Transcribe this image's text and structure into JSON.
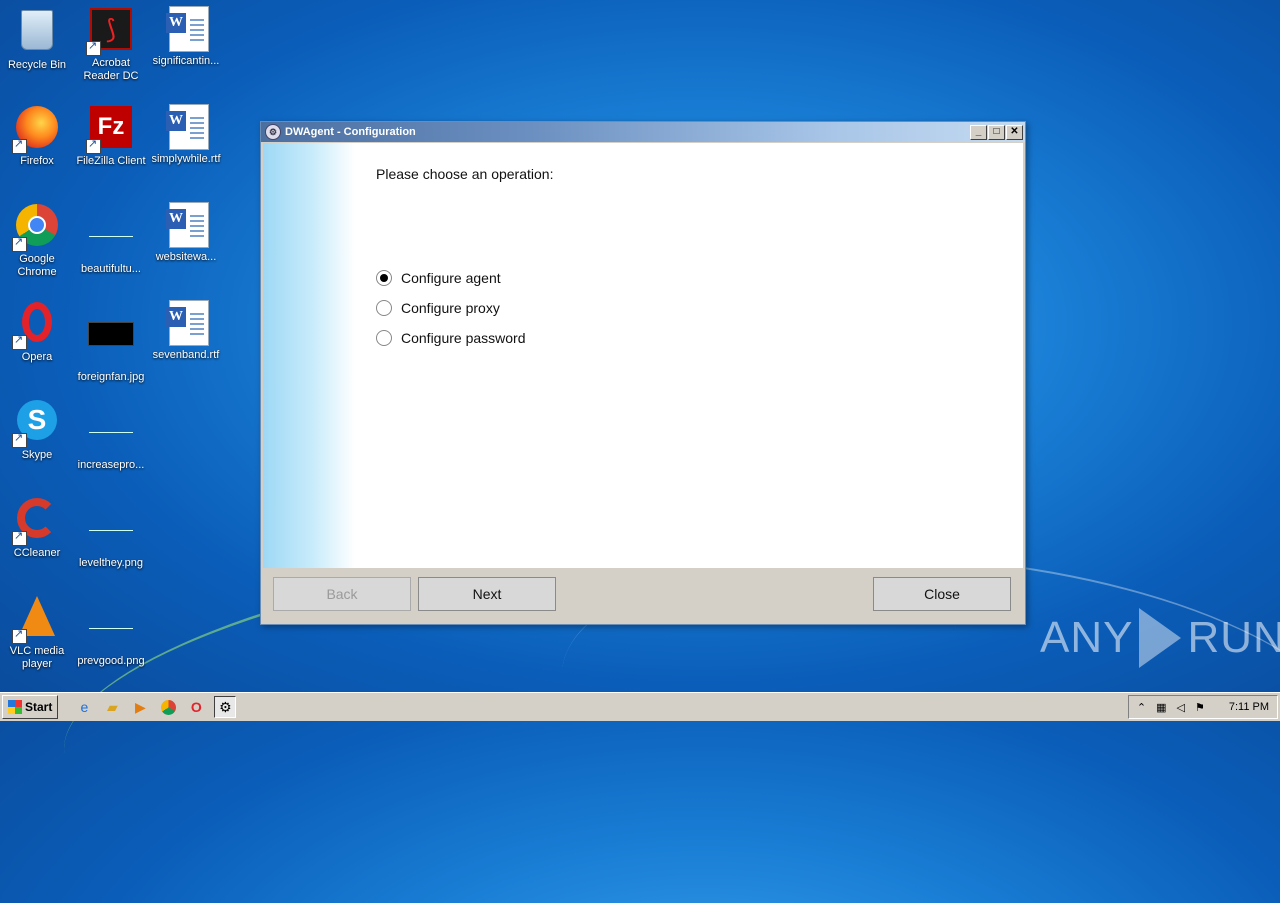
{
  "desktop": {
    "icons": [
      {
        "label": "Recycle Bin",
        "icon": "recycle-bin-icon"
      },
      {
        "label": "Acrobat Reader DC",
        "icon": "acrobat-icon"
      },
      {
        "label": "significantin...",
        "icon": "word-doc-icon"
      },
      {
        "label": "Firefox",
        "icon": "firefox-icon"
      },
      {
        "label": "FileZilla Client",
        "icon": "filezilla-icon"
      },
      {
        "label": "simplywhile.rtf",
        "icon": "word-doc-icon"
      },
      {
        "label": "Google Chrome",
        "icon": "chrome-icon"
      },
      {
        "label": "beautifultu...",
        "icon": "image-file-icon"
      },
      {
        "label": "websitewa...",
        "icon": "word-doc-icon"
      },
      {
        "label": "Opera",
        "icon": "opera-icon"
      },
      {
        "label": "foreignfan.jpg",
        "icon": "image-file-icon"
      },
      {
        "label": "sevenband.rtf",
        "icon": "word-doc-icon"
      },
      {
        "label": "Skype",
        "icon": "skype-icon"
      },
      {
        "label": "increasepro...",
        "icon": "image-file-icon"
      },
      {
        "label": "CCleaner",
        "icon": "ccleaner-icon"
      },
      {
        "label": "levelthey.png",
        "icon": "image-file-icon"
      },
      {
        "label": "VLC media player",
        "icon": "vlc-icon"
      },
      {
        "label": "prevgood.png",
        "icon": "image-file-icon"
      }
    ]
  },
  "window": {
    "title": "DWAgent - Configuration",
    "prompt": "Please choose an operation:",
    "options": [
      {
        "label": "Configure agent",
        "selected": true
      },
      {
        "label": "Configure proxy",
        "selected": false
      },
      {
        "label": "Configure password",
        "selected": false
      }
    ],
    "buttons": {
      "back": "Back",
      "next": "Next",
      "close": "Close"
    },
    "back_enabled": false
  },
  "watermark": {
    "left": "ANY",
    "right": "RUN"
  },
  "taskbar": {
    "start_label": "Start",
    "clock": "7:11 PM",
    "pinned": [
      "internet-explorer-icon",
      "folder-icon",
      "media-player-icon",
      "chrome-icon",
      "opera-icon",
      "dwagent-icon"
    ]
  },
  "colors": {
    "desktop": "#1a7fd6",
    "titlebar": "#4a6fa0",
    "sidebar_gradient": "#9ed8f5"
  }
}
